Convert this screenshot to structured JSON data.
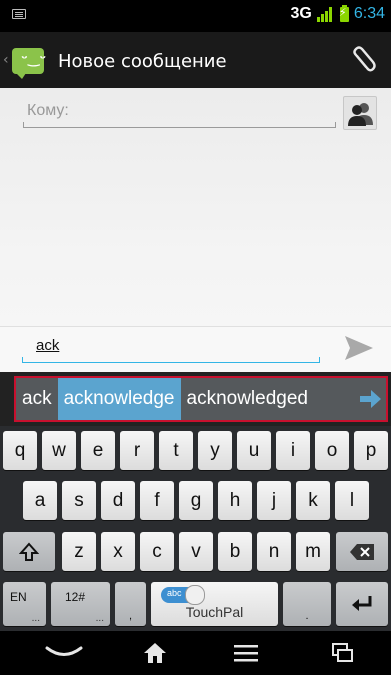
{
  "status_bar": {
    "network": "3G",
    "time": "6:34",
    "icons": [
      "keyboard-notification-icon",
      "signal-icon",
      "battery-charging-icon"
    ]
  },
  "action_bar": {
    "title": "Новое сообщение",
    "icons": [
      "messaging-app-icon",
      "paperclip-attach-icon"
    ]
  },
  "compose": {
    "to_placeholder": "Кому:",
    "message_text": "ack",
    "icons": [
      "add-contact-icon",
      "send-icon"
    ]
  },
  "suggestions": {
    "items": [
      "ack",
      "acknowledge",
      "acknowledged"
    ],
    "highlighted_index": 1,
    "icons": [
      "more-arrow-icon"
    ]
  },
  "keyboard": {
    "row1": [
      "q",
      "w",
      "e",
      "r",
      "t",
      "y",
      "u",
      "i",
      "o",
      "p"
    ],
    "row2": [
      "a",
      "s",
      "d",
      "f",
      "g",
      "h",
      "j",
      "k",
      "l"
    ],
    "row3": [
      "z",
      "x",
      "c",
      "v",
      "b",
      "n",
      "m"
    ],
    "lang": "EN",
    "lang_hint": "...",
    "numbers": "12#",
    "numbers_hint": "...",
    "comma": ",",
    "period": ".",
    "toggle_label": "abc",
    "space_label": "TouchPal",
    "icons": [
      "shift-icon",
      "backspace-icon",
      "enter-icon"
    ]
  },
  "nav_bar": {
    "icons": [
      "back-hide-keyboard-icon",
      "home-icon",
      "menu-icon",
      "recent-apps-icon"
    ]
  },
  "colors": {
    "accent": "#33b5e5",
    "signal": "#8bd600",
    "suggest_highlight": "#5ba4cf",
    "highlight_frame": "#c8102e"
  }
}
